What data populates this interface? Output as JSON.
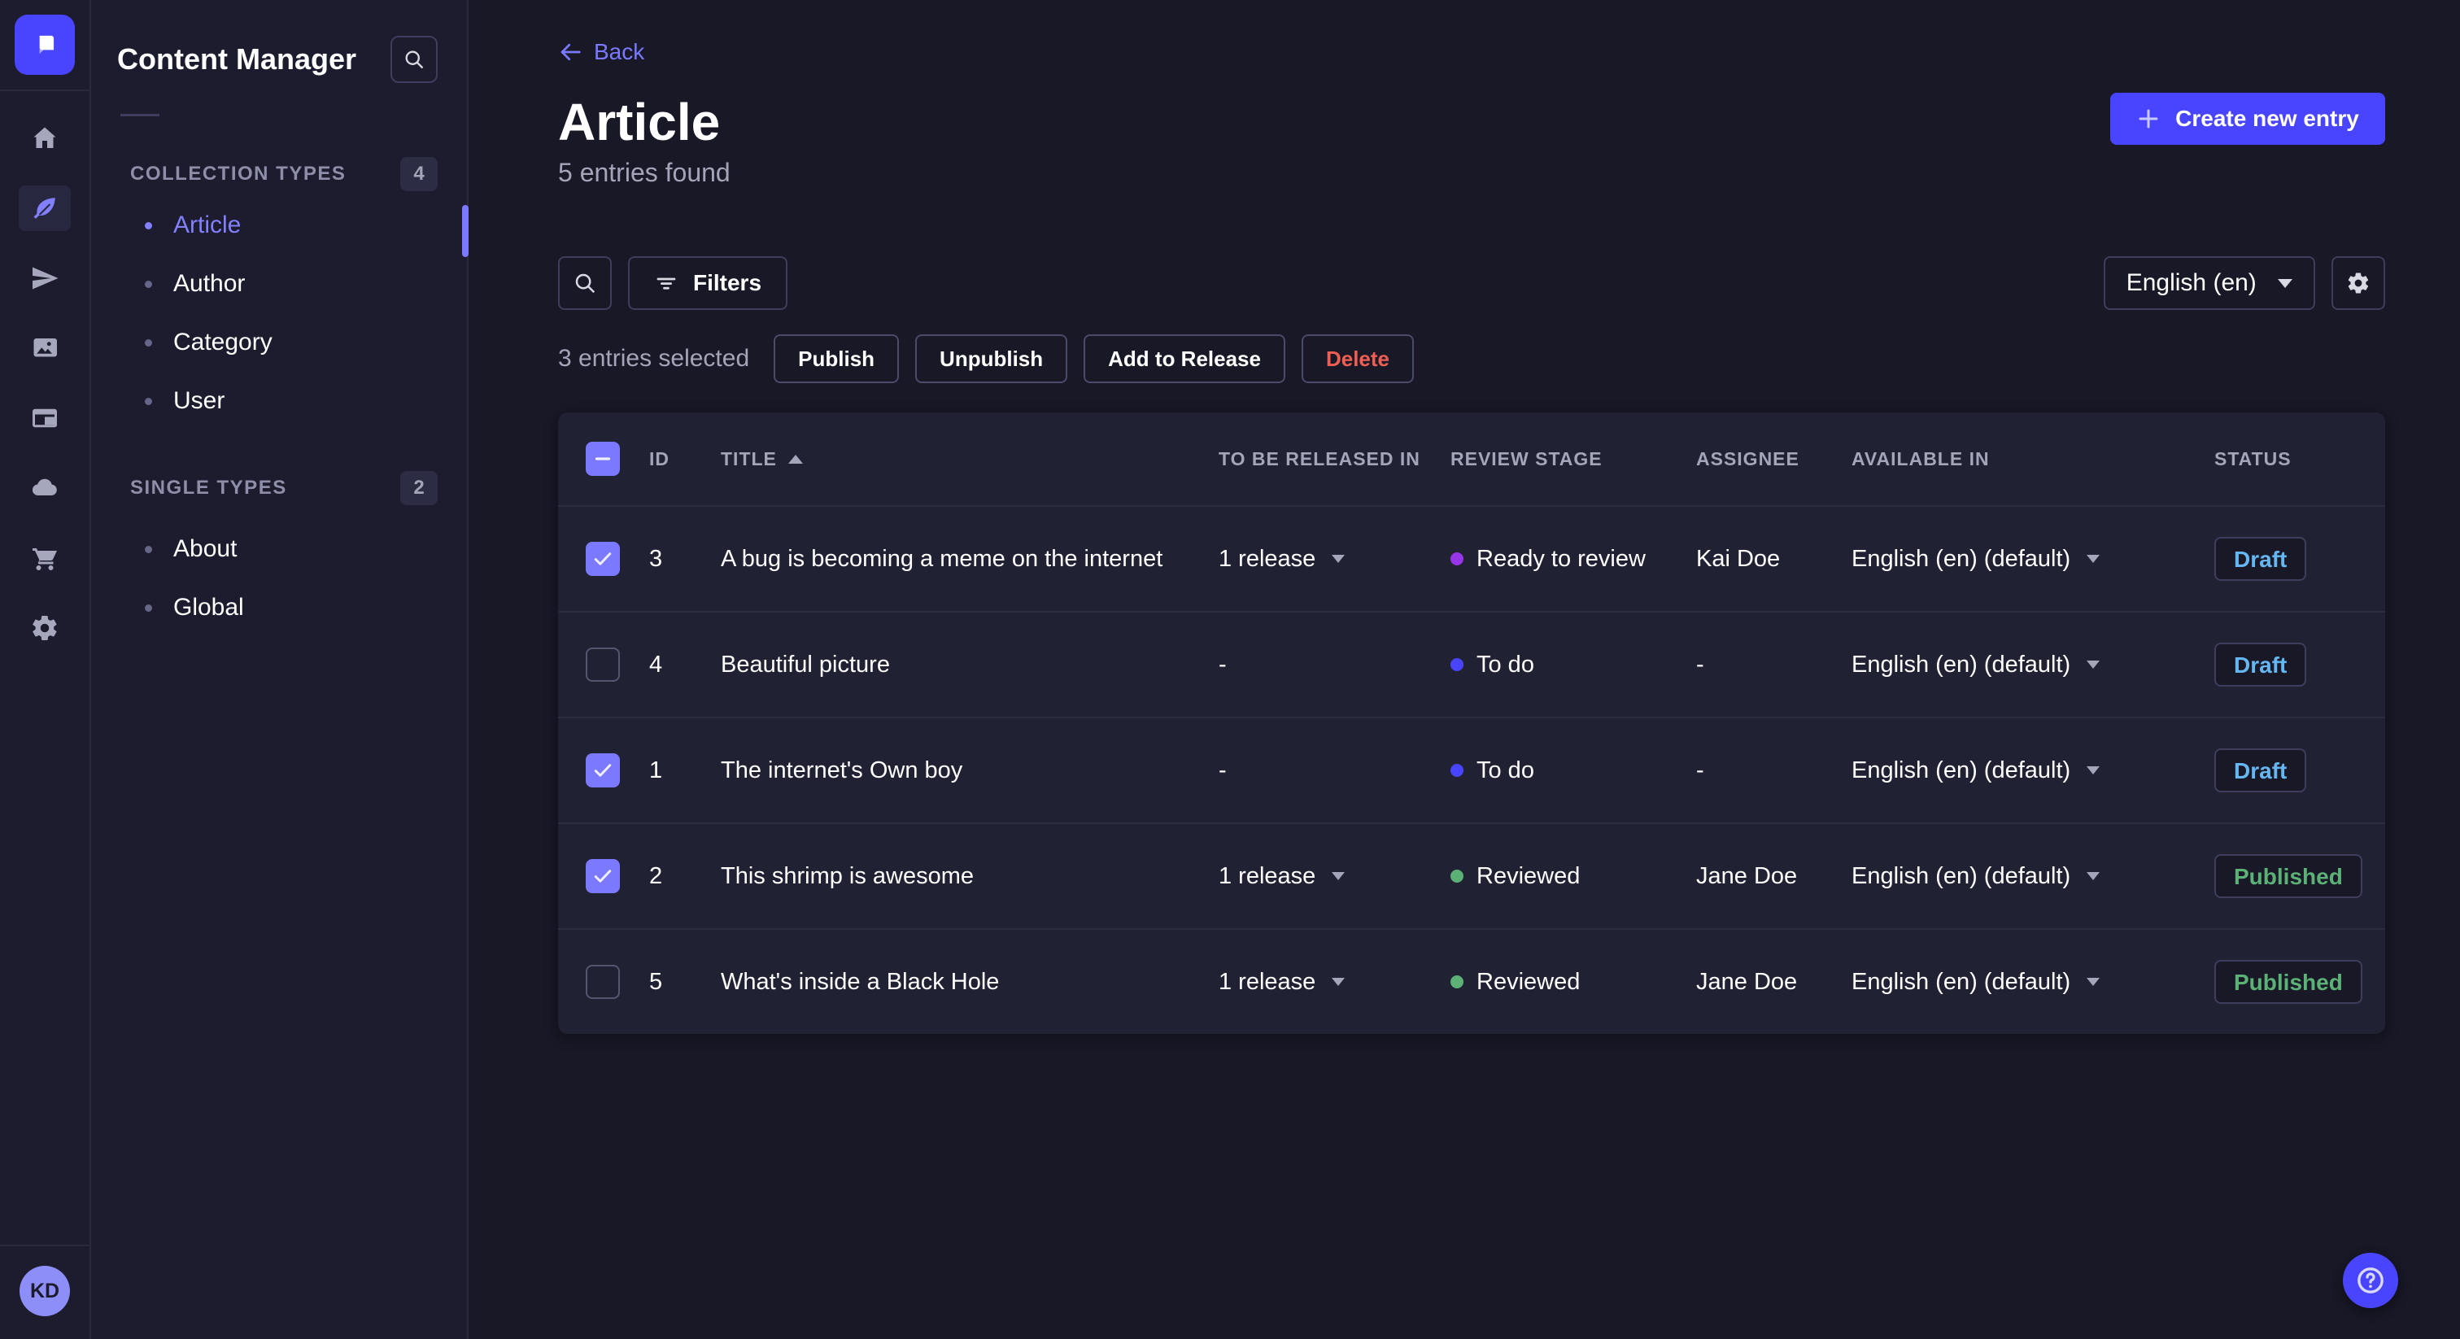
{
  "brand": {
    "primary_color": "#4945ff",
    "accent_text_color": "#7b79ff"
  },
  "nav_rail": {
    "logo_icon": "strapi-logo",
    "icons": [
      "home-icon",
      "feather-icon",
      "paper-plane-icon",
      "images-icon",
      "layout-icon",
      "cloud-icon",
      "cart-icon",
      "gear-icon"
    ],
    "active_icon": "feather-icon",
    "avatar_initials": "KD"
  },
  "sidebar": {
    "title": "Content Manager",
    "search_icon": "search-icon",
    "sections": [
      {
        "label": "COLLECTION TYPES",
        "count": "4",
        "items": [
          {
            "label": "Article",
            "active": true
          },
          {
            "label": "Author",
            "active": false
          },
          {
            "label": "Category",
            "active": false
          },
          {
            "label": "User",
            "active": false
          }
        ]
      },
      {
        "label": "SINGLE TYPES",
        "count": "2",
        "items": [
          {
            "label": "About",
            "active": false
          },
          {
            "label": "Global",
            "active": false
          }
        ]
      }
    ]
  },
  "header": {
    "back_label": "Back",
    "title": "Article",
    "subtitle": "5 entries found",
    "create_button": "Create new entry"
  },
  "toolbar": {
    "filters_label": "Filters",
    "locale_value": "English (en)"
  },
  "selection": {
    "text": "3 entries selected",
    "actions": [
      "Publish",
      "Unpublish",
      "Add to Release",
      "Delete"
    ]
  },
  "table": {
    "columns": [
      "ID",
      "TITLE",
      "TO BE RELEASED IN",
      "REVIEW STAGE",
      "ASSIGNEE",
      "AVAILABLE IN",
      "STATUS"
    ],
    "sort": {
      "column": "TITLE",
      "direction": "asc"
    },
    "review_stage_colors": {
      "Ready to review": "#9736e8",
      "To do": "#4945ff",
      "Reviewed": "#5cb176"
    },
    "status_colors": {
      "Draft": "#66b7f1",
      "Published": "#5cb176"
    },
    "rows": [
      {
        "selected": true,
        "id": "3",
        "title": "A bug is becoming a meme on the internet",
        "to_be_released_in": "1 release",
        "review_stage": "Ready to review",
        "assignee": "Kai Doe",
        "available_in": "English (en) (default)",
        "status": "Draft"
      },
      {
        "selected": false,
        "id": "4",
        "title": "Beautiful picture",
        "to_be_released_in": "-",
        "review_stage": "To do",
        "assignee": "-",
        "available_in": "English (en) (default)",
        "status": "Draft"
      },
      {
        "selected": true,
        "id": "1",
        "title": "The internet's Own boy",
        "to_be_released_in": "-",
        "review_stage": "To do",
        "assignee": "-",
        "available_in": "English (en) (default)",
        "status": "Draft"
      },
      {
        "selected": true,
        "id": "2",
        "title": "This shrimp is awesome",
        "to_be_released_in": "1 release",
        "review_stage": "Reviewed",
        "assignee": "Jane Doe",
        "available_in": "English (en) (default)",
        "status": "Published"
      },
      {
        "selected": false,
        "id": "5",
        "title": "What's inside a Black Hole",
        "to_be_released_in": "1 release",
        "review_stage": "Reviewed",
        "assignee": "Jane Doe",
        "available_in": "English (en) (default)",
        "status": "Published"
      }
    ]
  }
}
